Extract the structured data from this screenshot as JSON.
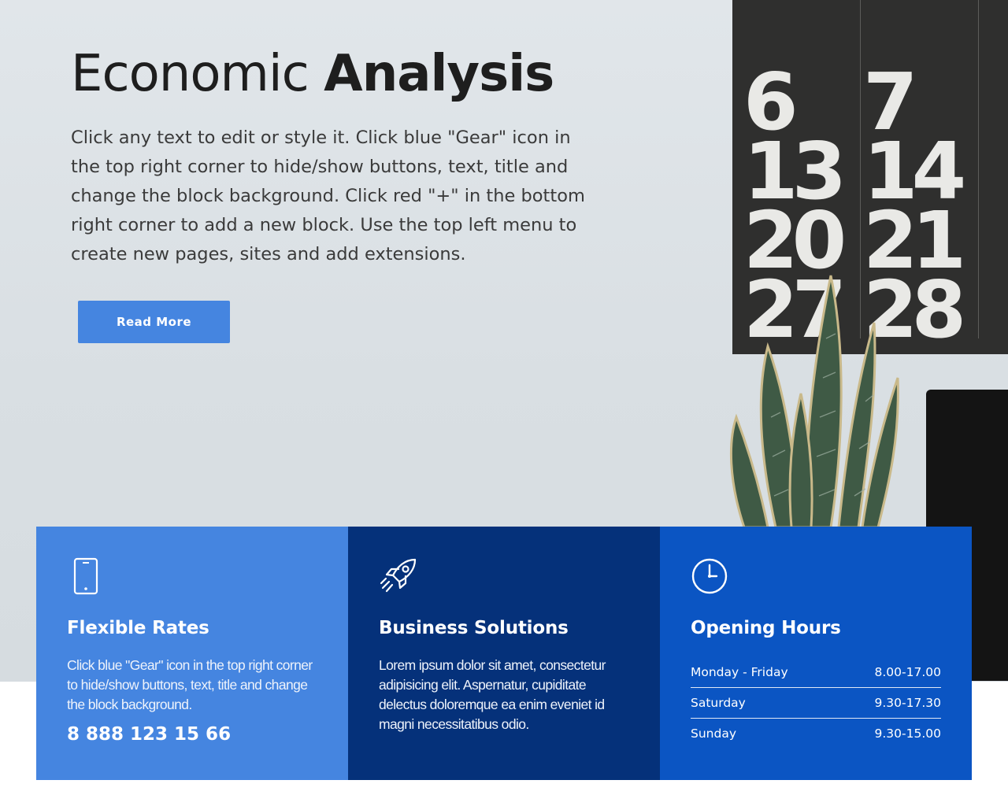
{
  "hero": {
    "title_light": "Economic",
    "title_bold": "Analysis",
    "lead": "Click any text to edit or style it. Click blue \"Gear\" icon in the top right corner to hide/show buttons, text, title and change the block background. Click red \"+\" in the bottom right corner to add a new block. Use the top left menu to create new pages, sites and add extensions.",
    "button_label": "Read More",
    "calendar_numbers": [
      "6",
      "7",
      "13",
      "14",
      "20",
      "21",
      "27",
      "28"
    ]
  },
  "cards": [
    {
      "icon": "mobile-phone-icon",
      "title": "Flexible Rates",
      "text": "Click blue \"Gear\" icon in the top right corner to hide/show buttons, text, title and change the block background.",
      "phone": "8 888 123 15 66"
    },
    {
      "icon": "rocket-icon",
      "title": "Business Solutions",
      "text": "Lorem ipsum dolor sit amet, consectetur adipisicing elit. Aspernatur, cupiditate delectus doloremque ea enim eveniet id magni necessitatibus odio."
    },
    {
      "icon": "clock-icon",
      "title": "Opening Hours",
      "hours": [
        {
          "day": "Monday - Friday",
          "time": "8.00-17.00"
        },
        {
          "day": "Saturday",
          "time": "9.30-17.30"
        },
        {
          "day": "Sunday",
          "time": "9.30-15.00"
        }
      ]
    }
  ],
  "colors": {
    "accent": "#4585e0",
    "card_light": "#4585e0",
    "card_dark": "#05317a",
    "card_medium": "#0b55c3"
  }
}
